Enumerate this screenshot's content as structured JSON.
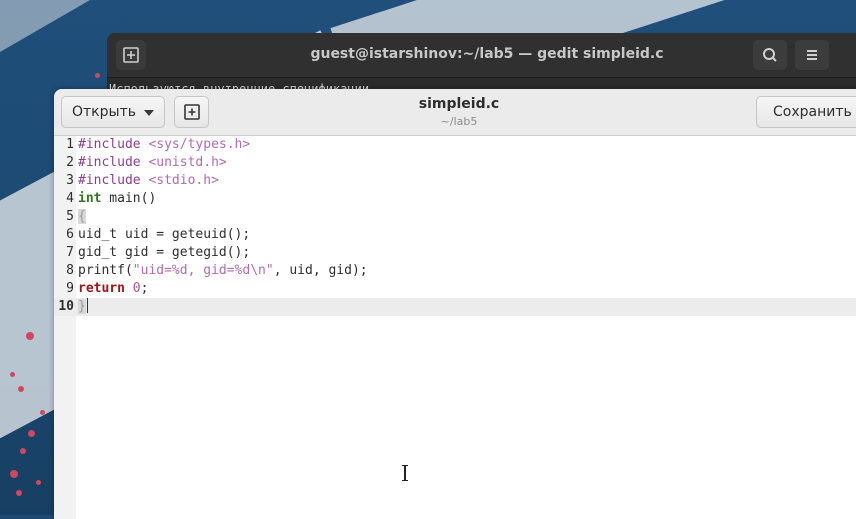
{
  "terminal": {
    "title": "guest@istarshinov:~/lab5 — gedit simpleid.c",
    "output_line": "Используются внутренние спецификации"
  },
  "gedit": {
    "open_label": "Открыть",
    "save_label": "Сохранить",
    "doc_title": "simpleid.c",
    "doc_path": "~/lab5"
  },
  "editor": {
    "line_numbers": [
      "1",
      "2",
      "3",
      "4",
      "5",
      "6",
      "7",
      "8",
      "9",
      "10"
    ],
    "current_line": 10,
    "lines": [
      "#include <sys/types.h>",
      "#include <unistd.h>",
      "#include <stdio.h>",
      "int main()",
      "{",
      "uid_t uid = geteuid();",
      "gid_t gid = getegid();",
      "printf(\"uid=%d, gid=%d\\n\", uid, gid);",
      "return 0;",
      "}"
    ]
  }
}
